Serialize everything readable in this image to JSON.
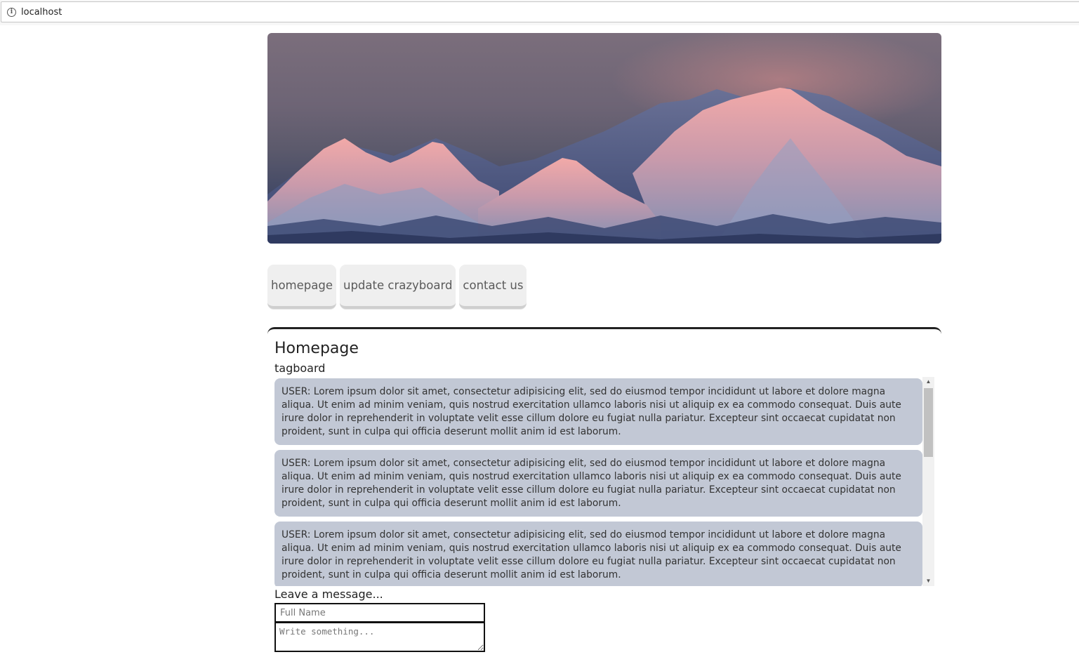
{
  "browser": {
    "url": "localhost"
  },
  "banner": {
    "alt": "snowy mountain range at sunset"
  },
  "nav": {
    "items": [
      {
        "label": "homepage"
      },
      {
        "label": "update crazyboard"
      },
      {
        "label": "contact us"
      }
    ]
  },
  "main": {
    "title": "Homepage",
    "tagboard_label": "tagboard",
    "messages": [
      {
        "text": "USER: Lorem ipsum dolor sit amet, consectetur adipisicing elit, sed do eiusmod tempor incididunt ut labore et dolore magna aliqua. Ut enim ad minim veniam, quis nostrud exercitation ullamco laboris nisi ut aliquip ex ea commodo consequat. Duis aute irure dolor in reprehenderit in voluptate velit esse cillum dolore eu fugiat nulla pariatur. Excepteur sint occaecat cupidatat non proident, sunt in culpa qui officia deserunt mollit anim id est laborum."
      },
      {
        "text": "USER: Lorem ipsum dolor sit amet, consectetur adipisicing elit, sed do eiusmod tempor incididunt ut labore et dolore magna aliqua. Ut enim ad minim veniam, quis nostrud exercitation ullamco laboris nisi ut aliquip ex ea commodo consequat. Duis aute irure dolor in reprehenderit in voluptate velit esse cillum dolore eu fugiat nulla pariatur. Excepteur sint occaecat cupidatat non proident, sunt in culpa qui officia deserunt mollit anim id est laborum."
      },
      {
        "text": "USER: Lorem ipsum dolor sit amet, consectetur adipisicing elit, sed do eiusmod tempor incididunt ut labore et dolore magna aliqua. Ut enim ad minim veniam, quis nostrud exercitation ullamco laboris nisi ut aliquip ex ea commodo consequat. Duis aute irure dolor in reprehenderit in voluptate velit esse cillum dolore eu fugiat nulla pariatur. Excepteur sint occaecat cupidatat non proident, sunt in culpa qui officia deserunt mollit anim id est laborum."
      }
    ],
    "form": {
      "label": "Leave a message...",
      "name_placeholder": "Full Name",
      "name_value": "",
      "message_placeholder": "Write something...",
      "message_value": ""
    }
  },
  "colors": {
    "message_bg": "#c2c8d5",
    "nav_bg": "#efefef",
    "panel_border": "#222222"
  }
}
